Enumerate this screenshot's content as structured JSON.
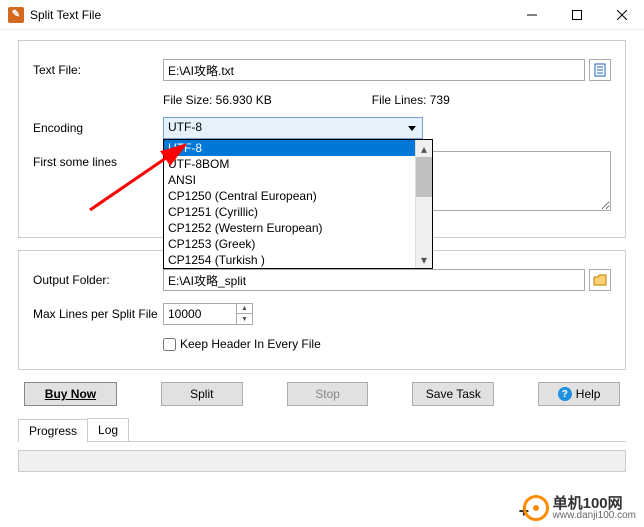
{
  "window": {
    "title": "Split Text File"
  },
  "labels": {
    "textFile": "Text File:",
    "encoding": "Encoding",
    "firstLines": "First some lines",
    "outputFolder": "Output Folder:",
    "maxLines": "Max Lines per Split File",
    "keepHeader": "Keep Header In Every File"
  },
  "fields": {
    "textFile": "E:\\AI攻略.txt",
    "outputFolder": "E:\\AI攻略_split",
    "maxLines": "10000",
    "firstLines": ""
  },
  "info": {
    "fileSize": "File Size: 56.930 KB",
    "fileLines": "File Lines: 739"
  },
  "encoding": {
    "selected": "UTF-8",
    "options": [
      "UTF-8",
      "UTF-8BOM",
      "ANSI",
      "CP1250 (Central European)",
      "CP1251 (Cyrillic)",
      "CP1252 (Western European)",
      "CP1253 (Greek)",
      "CP1254 (Turkish )"
    ]
  },
  "buttons": {
    "buyNow": "Buy Now",
    "split": "Split",
    "stop": "Stop",
    "saveTask": "Save Task",
    "help": "Help"
  },
  "tabs": {
    "progress": "Progress",
    "log": "Log"
  },
  "watermark": {
    "cn": "单机100网",
    "url": "www.danji100.com"
  }
}
